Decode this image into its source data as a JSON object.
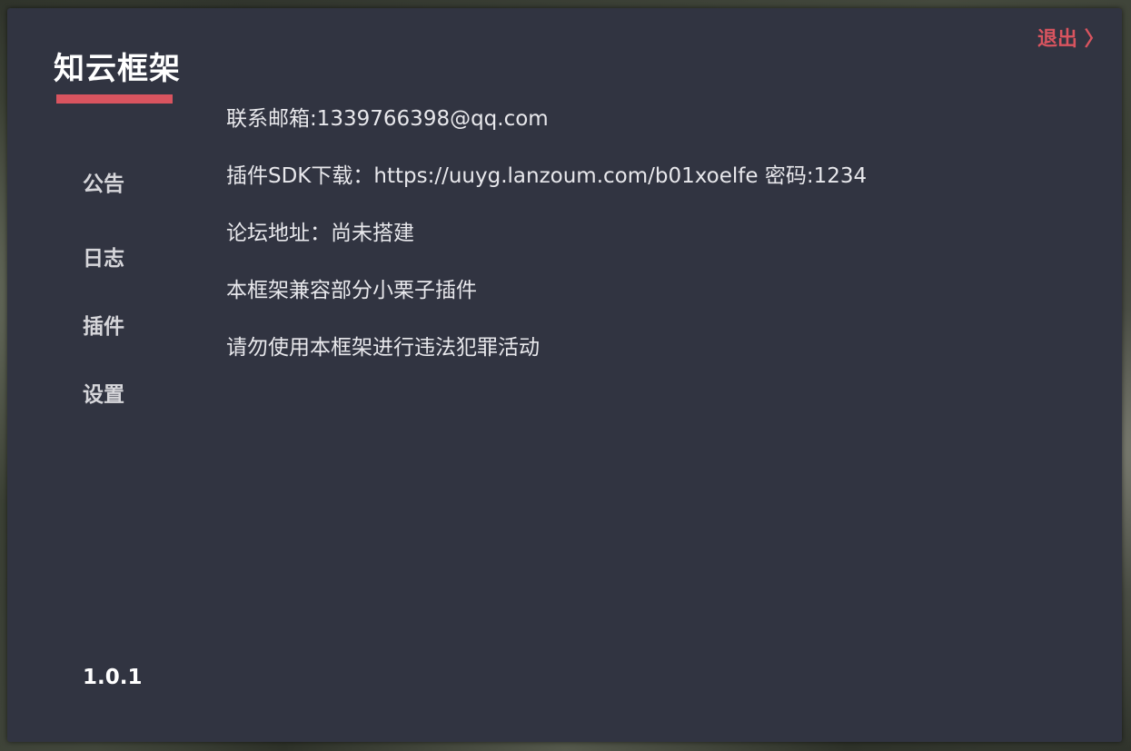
{
  "app": {
    "title": "知云框架",
    "exit_label": "退出 〉",
    "version": "1.0.1",
    "accent_color": "#d9545f",
    "background_color": "#313441"
  },
  "nav": {
    "items": [
      {
        "label": "公告"
      },
      {
        "label": "日志"
      },
      {
        "label": "插件"
      },
      {
        "label": "设置"
      }
    ]
  },
  "notice": {
    "lines": [
      "联系邮箱:1339766398@qq.com",
      "插件SDK下载：https://uuyg.lanzoum.com/b01xoelfe  密码:1234",
      "论坛地址：尚未搭建",
      "本框架兼容部分小栗子插件",
      "请勿使用本框架进行违法犯罪活动"
    ]
  }
}
